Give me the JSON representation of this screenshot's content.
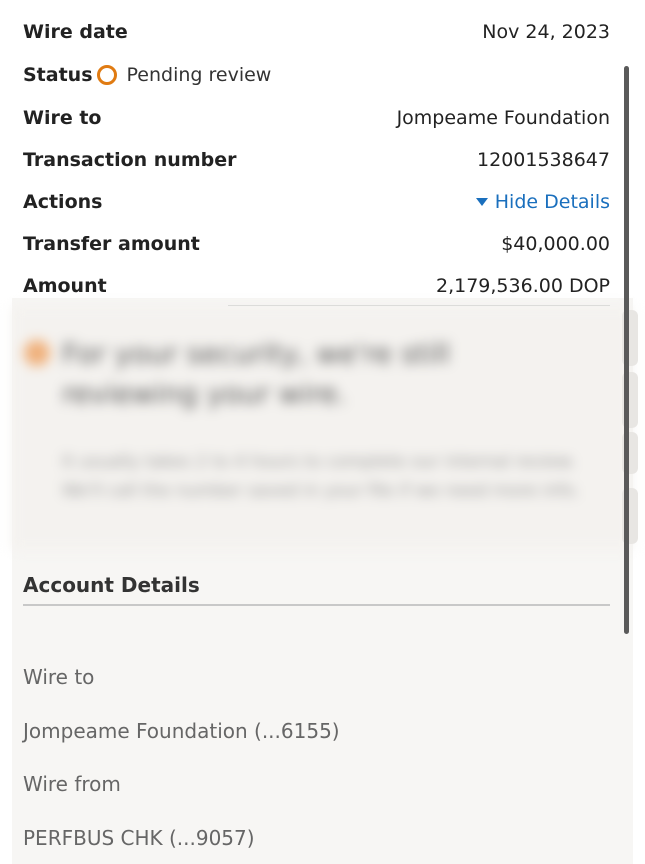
{
  "summary": {
    "wire_date_label": "Wire date",
    "wire_date_value": "Nov 24, 2023",
    "status_label": "Status",
    "status_value": "Pending review",
    "wire_to_label": "Wire to",
    "wire_to_value": "Jompeame Foundation",
    "transaction_label": "Transaction number",
    "transaction_value": "12001538647",
    "actions_label": "Actions",
    "actions_link": "Hide Details",
    "transfer_label": "Transfer amount",
    "transfer_value": "$40,000.00",
    "amount_label": "Amount",
    "amount_value": "2,179,536.00 DOP"
  },
  "alert": {
    "title": "For your security, we're still reviewing your wire.",
    "body": "It usually takes 2 to 4 hours to complete our internal review. We'll call the number saved in your file if we need more info."
  },
  "account_details": {
    "title": "Account Details",
    "wire_to_label": "Wire to",
    "wire_to_value": "Jompeame Foundation (...6155)",
    "wire_from_label": "Wire from",
    "wire_from_value": "PERFBUS CHK (...9057)"
  },
  "colors": {
    "status_ring": "#e07b12",
    "link": "#1a6fbd",
    "panel_bg": "#f7f6f4"
  },
  "icons": {
    "status": "status-ring-icon",
    "expand": "caret-down-icon"
  }
}
